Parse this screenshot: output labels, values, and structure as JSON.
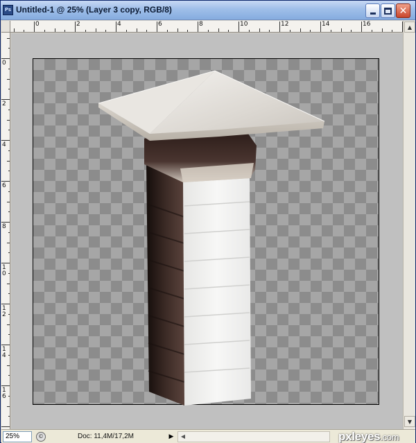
{
  "window": {
    "title": "Untitled-1 @ 25% (Layer 3 copy, RGB/8)",
    "app_icon_text": "Ps",
    "controls": {
      "minimize": "minimize",
      "maximize": "maximize",
      "close": "close"
    }
  },
  "rulers": {
    "horizontal_labels": [
      "0",
      "2",
      "4",
      "6",
      "8",
      "10",
      "12",
      "14",
      "16"
    ],
    "vertical_labels": [
      "0",
      "2",
      "4",
      "6",
      "8",
      "10",
      "12",
      "14",
      "16"
    ]
  },
  "canvas": {
    "layer": "Layer 3 copy",
    "content": "transparency checkerboard with pillar image"
  },
  "statusbar": {
    "zoom": "25%",
    "doc_info": "Doc: 11,4M/17,2M"
  },
  "watermark": {
    "brand": "pxleyes",
    "suffix": ".com"
  },
  "icons": {
    "app": "photoshop-icon",
    "scroll_up": "arrow-up-icon",
    "scroll_down": "arrow-down-icon",
    "status_menu": "arrow-right-icon"
  }
}
